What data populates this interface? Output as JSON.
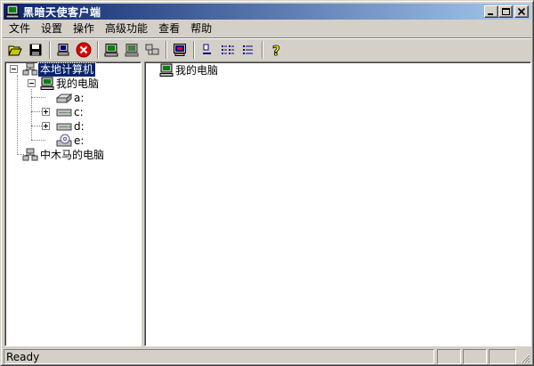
{
  "window": {
    "title": "黑暗天使客户端"
  },
  "menu": [
    {
      "label": "文件"
    },
    {
      "label": "设置"
    },
    {
      "label": "操作"
    },
    {
      "label": "高级功能"
    },
    {
      "label": "查看"
    },
    {
      "label": "帮助"
    }
  ],
  "toolbar": {
    "buttons": [
      {
        "icon": "open-folder-icon"
      },
      {
        "icon": "save-icon"
      },
      {
        "icon": "computer-connect-icon"
      },
      {
        "icon": "stop-icon"
      },
      {
        "icon": "computer-icon"
      },
      {
        "icon": "computer-screen-icon"
      },
      {
        "icon": "network-icon"
      },
      {
        "icon": "remote-desktop-icon"
      },
      {
        "icon": "large-icons-icon"
      },
      {
        "icon": "list-view-icon"
      },
      {
        "icon": "details-view-icon"
      },
      {
        "icon": "help-icon"
      }
    ]
  },
  "tree": {
    "root": "本地计算机",
    "my_computer": "我的电脑",
    "drives": [
      "a:",
      "c:",
      "d:",
      "e:"
    ],
    "remote": "中木马的电脑"
  },
  "content": {
    "items": [
      {
        "label": "我的电脑"
      }
    ]
  },
  "status": {
    "text": "Ready"
  },
  "colors": {
    "title_start": "#0a246a",
    "title_end": "#a6caf0",
    "chrome": "#d4d0c8",
    "selection": "#0a246a"
  }
}
